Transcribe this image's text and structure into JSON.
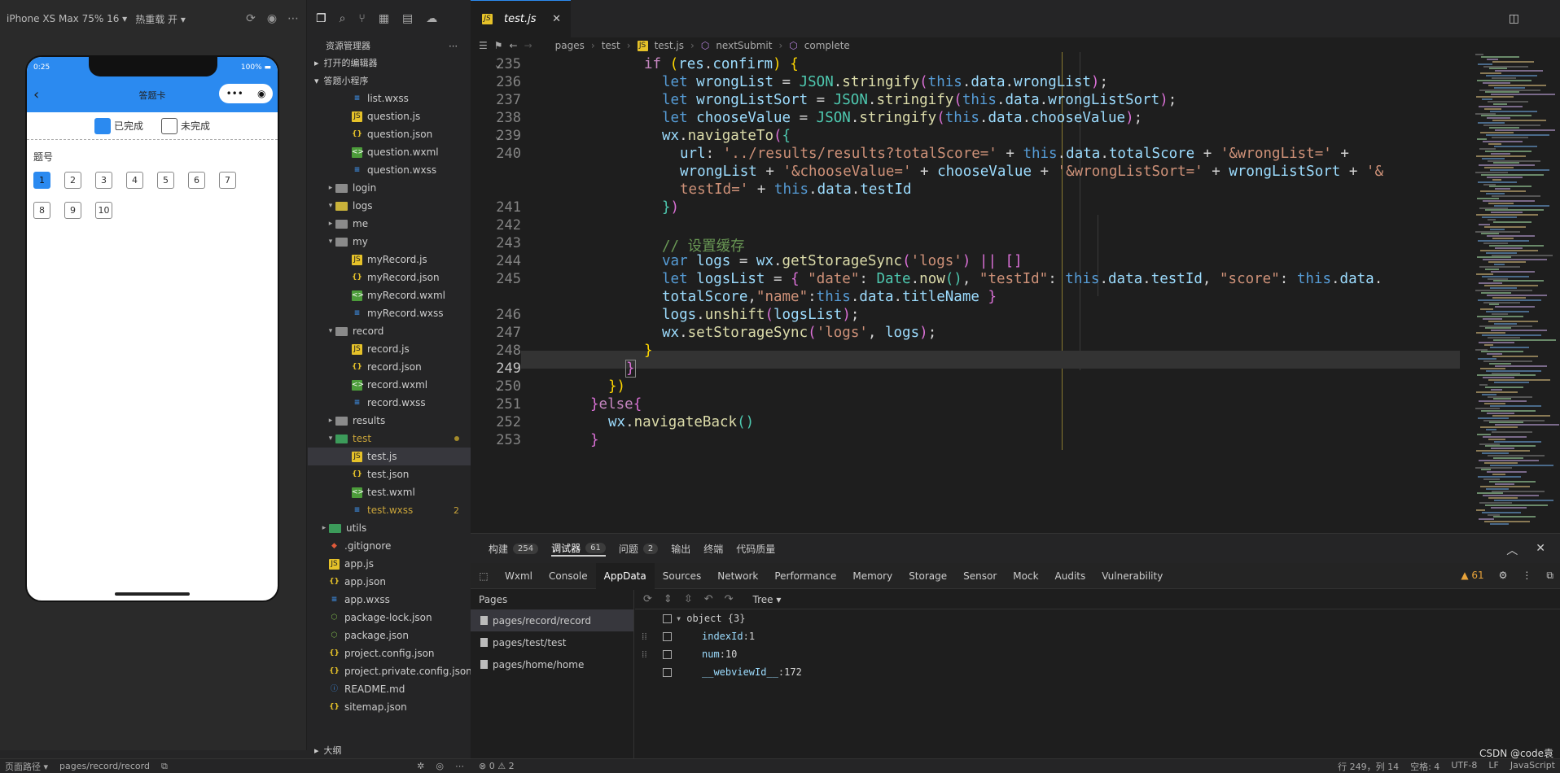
{
  "simulator": {
    "device": "iPhone XS Max 75% 16 ▾",
    "hotreload": "热重载 开 ▾",
    "status_time": "0:25",
    "status_battery": "100%",
    "nav_title": "答题卡",
    "legend_done": "已完成",
    "legend_todo": "未完成",
    "question_label": "题号",
    "questions": [
      "1",
      "2",
      "3",
      "4",
      "5",
      "6",
      "7",
      "8",
      "9",
      "10"
    ],
    "colors": {
      "accent": "#2b8af0"
    }
  },
  "explorer": {
    "title": "资源管理器",
    "open_editors": "打开的编辑器",
    "project": "答题小程序",
    "items": [
      {
        "label": "list.wxss",
        "icon": "wxss"
      },
      {
        "label": "question.js",
        "icon": "js"
      },
      {
        "label": "question.json",
        "icon": "json"
      },
      {
        "label": "question.wxml",
        "icon": "wxml"
      },
      {
        "label": "question.wxss",
        "icon": "wxss"
      },
      {
        "label": "login",
        "icon": "folder"
      },
      {
        "label": "logs",
        "icon": "folder-open"
      },
      {
        "label": "me",
        "icon": "folder"
      },
      {
        "label": "my",
        "icon": "folder-open"
      },
      {
        "label": "myRecord.js",
        "icon": "js"
      },
      {
        "label": "myRecord.json",
        "icon": "json"
      },
      {
        "label": "myRecord.wxml",
        "icon": "wxml"
      },
      {
        "label": "myRecord.wxss",
        "icon": "wxss"
      },
      {
        "label": "record",
        "icon": "folder-open"
      },
      {
        "label": "record.js",
        "icon": "js"
      },
      {
        "label": "record.json",
        "icon": "json"
      },
      {
        "label": "record.wxml",
        "icon": "wxml"
      },
      {
        "label": "record.wxss",
        "icon": "wxss"
      },
      {
        "label": "results",
        "icon": "folder"
      },
      {
        "label": "test",
        "icon": "folder-open"
      },
      {
        "label": "test.js",
        "icon": "js"
      },
      {
        "label": "test.json",
        "icon": "json"
      },
      {
        "label": "test.wxml",
        "icon": "wxml"
      },
      {
        "label": "test.wxss",
        "icon": "wxss",
        "badge": "2"
      },
      {
        "label": "utils",
        "icon": "folder"
      },
      {
        "label": ".gitignore",
        "icon": "git"
      },
      {
        "label": "app.js",
        "icon": "js"
      },
      {
        "label": "app.json",
        "icon": "json"
      },
      {
        "label": "app.wxss",
        "icon": "wxss"
      },
      {
        "label": "package-lock.json",
        "icon": "pkg"
      },
      {
        "label": "package.json",
        "icon": "pkg"
      },
      {
        "label": "project.config.json",
        "icon": "json"
      },
      {
        "label": "project.private.config.json",
        "icon": "json"
      },
      {
        "label": "README.md",
        "icon": "md"
      },
      {
        "label": "sitemap.json",
        "icon": "json"
      }
    ],
    "outline": "大纲"
  },
  "editor": {
    "tab_label": "test.js",
    "breadcrumb": [
      "pages",
      "test",
      "test.js",
      "nextSubmit",
      "complete"
    ],
    "line_numbers": [
      "235",
      "236",
      "237",
      "238",
      "239",
      "240",
      "",
      "",
      "241",
      "242",
      "243",
      "244",
      "245",
      "",
      "246",
      "247",
      "248",
      "249",
      "250",
      "251",
      "252",
      "253"
    ],
    "current_line": "249"
  },
  "panel": {
    "tabs": [
      {
        "label": "构建",
        "count": "254"
      },
      {
        "label": "调试器",
        "count": "61"
      },
      {
        "label": "问题",
        "count": "2"
      },
      {
        "label": "输出"
      },
      {
        "label": "终端"
      },
      {
        "label": "代码质量"
      }
    ],
    "devtools_tabs": [
      "Wxml",
      "Console",
      "AppData",
      "Sources",
      "Network",
      "Performance",
      "Memory",
      "Storage",
      "Sensor",
      "Mock",
      "Audits",
      "Vulnerability"
    ],
    "warnings": "▲ 61",
    "pages_header": "Pages",
    "pages": [
      "pages/record/record",
      "pages/test/test",
      "pages/home/home"
    ],
    "view_mode": "Tree",
    "tree": {
      "root": "object {3}",
      "rows": [
        {
          "key": "indexId",
          "value": "1"
        },
        {
          "key": "num",
          "value": "10"
        },
        {
          "key": "__webviewId__",
          "value": "172"
        }
      ]
    }
  },
  "statusbar": {
    "page_path_label": "页面路径 ▾",
    "page_path": "pages/record/record",
    "problems": "⊗ 0 ⚠ 2",
    "position": "行 249，列 14",
    "spaces": "空格: 4",
    "encoding": "UTF-8",
    "eol": "LF",
    "language": "JavaScript",
    "watermark": "CSDN @code袁"
  }
}
